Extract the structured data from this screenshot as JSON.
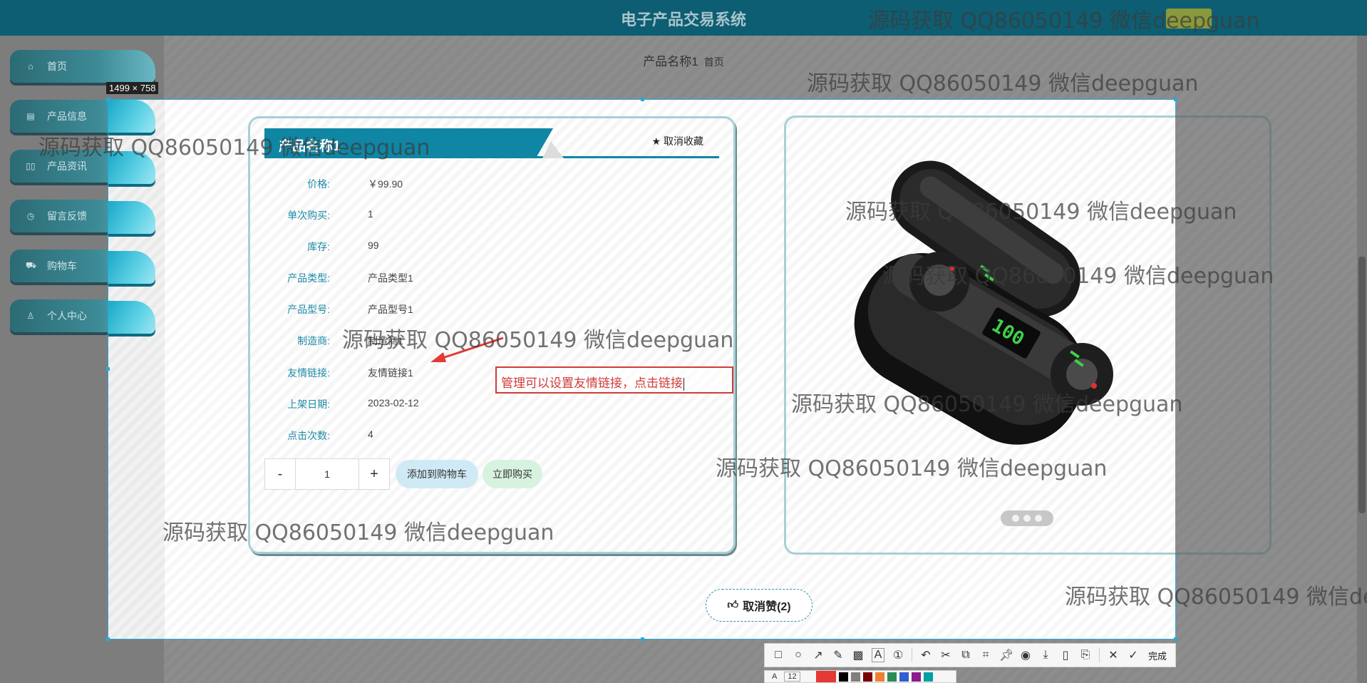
{
  "header": {
    "title": "电子产品交易系统"
  },
  "breadcrumb": {
    "current": "产品名称1",
    "home": "首页"
  },
  "sidebar": {
    "items": [
      {
        "label": "首页",
        "icon": "home-icon"
      },
      {
        "label": "产品信息",
        "icon": "printer-icon"
      },
      {
        "label": "产品资讯",
        "icon": "book-icon"
      },
      {
        "label": "留言反馈",
        "icon": "clock-icon"
      },
      {
        "label": "购物车",
        "icon": "cart-icon"
      },
      {
        "label": "个人中心",
        "icon": "user-icon"
      }
    ]
  },
  "capture": {
    "size_label": "1499 × 758"
  },
  "product": {
    "title": "产品名称1",
    "favorite_label": "取消收藏",
    "fields": [
      {
        "label": "价格:",
        "value": "￥99.90"
      },
      {
        "label": "单次购买:",
        "value": "1"
      },
      {
        "label": "库存:",
        "value": "99"
      },
      {
        "label": "产品类型:",
        "value": "产品类型1"
      },
      {
        "label": "产品型号:",
        "value": "产品型号1"
      },
      {
        "label": "制造商:",
        "value": "制造商1"
      },
      {
        "label": "友情链接:",
        "value": "友情链接1"
      },
      {
        "label": "上架日期:",
        "value": "2023-02-12"
      },
      {
        "label": "点击次数:",
        "value": "4"
      }
    ],
    "quantity": "1",
    "minus_label": "-",
    "plus_label": "+",
    "add_to_cart_label": "添加到购物车",
    "buy_now_label": "立即购买",
    "like_label": "取消赞(2)"
  },
  "annotation": {
    "text": "管理可以设置友情链接，点击链接",
    "color": "#d23a3a"
  },
  "watermark": {
    "text": "源码获取 QQ86050149 微信deepguan"
  },
  "toolbar": {
    "done_label": "完成",
    "font_size": "12",
    "colors": [
      "#e53935",
      "#000000",
      "#808080",
      "#7b0000",
      "#f08030",
      "#2e8b57",
      "#2f5fd0",
      "#8b1a8b",
      "#00a0a0"
    ]
  },
  "colors": {
    "header_bg": "#0d5e72",
    "accent": "#0f86a4"
  }
}
